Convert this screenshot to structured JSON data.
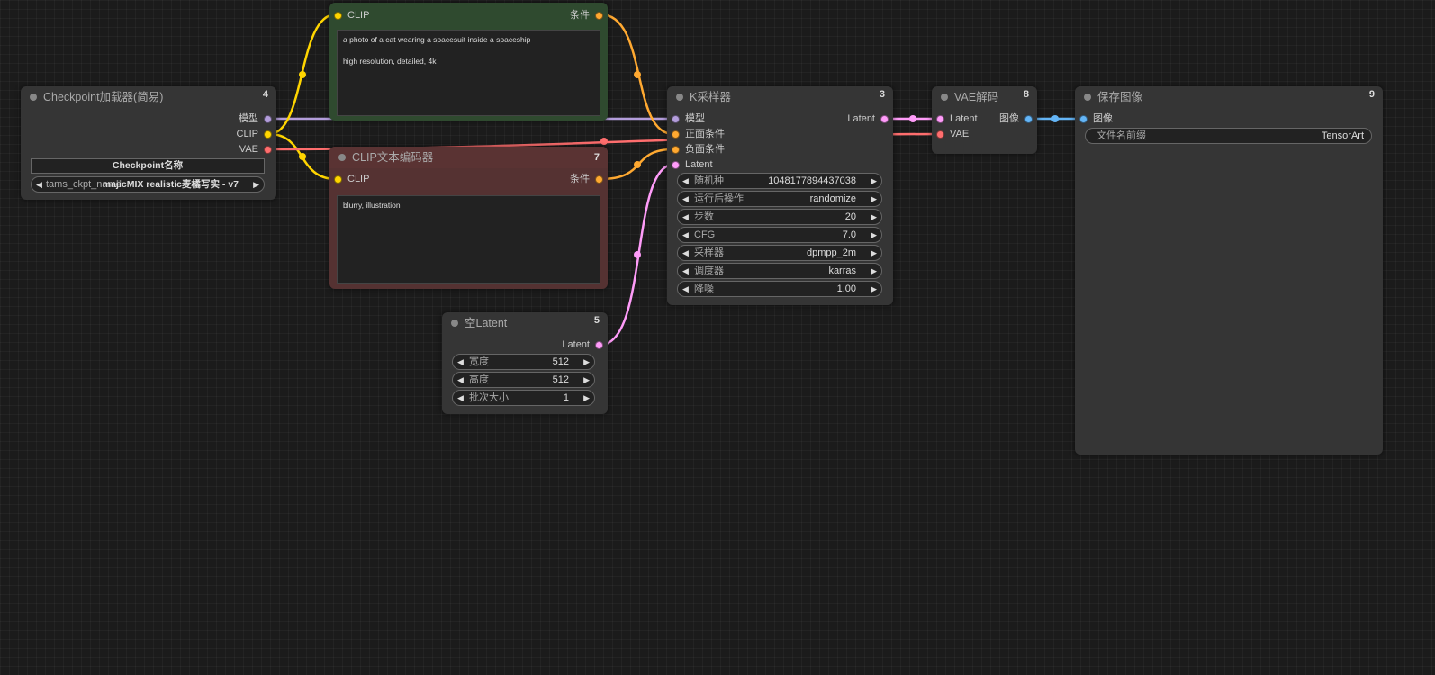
{
  "colors": {
    "model": "#b39ddb",
    "clip": "#ffd500",
    "vae": "#ff6e6e",
    "conditioning": "#ffa931",
    "latent": "#ff9cf9",
    "image": "#64b5f6",
    "positive_node_bg": "#2f4a2f",
    "positive_node_title": "#355737",
    "negative_node_bg": "#553232",
    "negative_node_title": "#5a3333"
  },
  "nodes": {
    "checkpoint": {
      "title": "Checkpoint加载器(简易)",
      "id": "4",
      "outputs": [
        "模型",
        "CLIP",
        "VAE"
      ],
      "widget_header": "Checkpoint名称",
      "widget_label": "tams_ckpt_name",
      "widget_value": "majicMIX realistic麦橘写实 - v7"
    },
    "positive": {
      "id": "6",
      "input": "CLIP",
      "output": "条件",
      "text": "a photo of a cat wearing a spacesuit inside a spaceship\n\nhigh resolution, detailed, 4k"
    },
    "negative": {
      "title": "CLIP文本编码器",
      "id": "7",
      "input": "CLIP",
      "output": "条件",
      "text": "blurry, illustration"
    },
    "ksampler": {
      "title": "K采样器",
      "id": "3",
      "inputs": [
        "模型",
        "正面条件",
        "负面条件",
        "Latent"
      ],
      "output": "Latent",
      "widgets": [
        {
          "label": "随机种",
          "value": "1048177894437038"
        },
        {
          "label": "运行后操作",
          "value": "randomize"
        },
        {
          "label": "步数",
          "value": "20"
        },
        {
          "label": "CFG",
          "value": "7.0"
        },
        {
          "label": "采样器",
          "value": "dpmpp_2m"
        },
        {
          "label": "调度器",
          "value": "karras"
        },
        {
          "label": "降噪",
          "value": "1.00"
        }
      ]
    },
    "empty_latent": {
      "title": "空Latent",
      "id": "5",
      "output": "Latent",
      "widgets": [
        {
          "label": "宽度",
          "value": "512"
        },
        {
          "label": "高度",
          "value": "512"
        },
        {
          "label": "批次大小",
          "value": "1"
        }
      ]
    },
    "vae_decode": {
      "title": "VAE解码",
      "id": "8",
      "inputs": [
        "Latent",
        "VAE"
      ],
      "output": "图像"
    },
    "save_image": {
      "title": "保存图像",
      "id": "9",
      "input": "图像",
      "widget_label": "文件名前缀",
      "widget_value": "TensorArt"
    }
  }
}
